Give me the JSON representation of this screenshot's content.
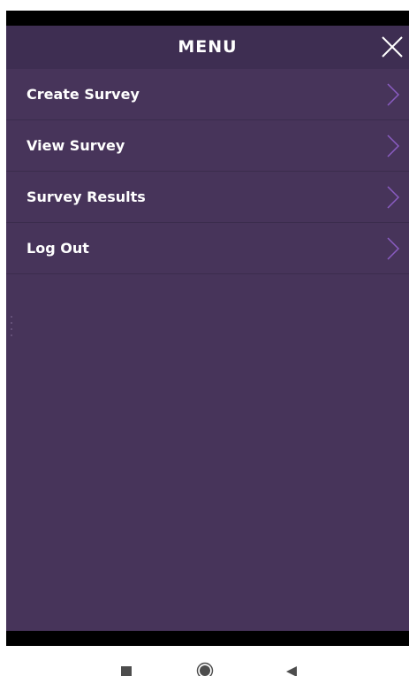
{
  "header": {
    "title": "MENU",
    "close_icon": "close-icon"
  },
  "menu": {
    "items": [
      {
        "label": "Create Survey",
        "icon": "chevron-right-icon"
      },
      {
        "label": "View Survey",
        "icon": "chevron-right-icon"
      },
      {
        "label": "Survey Results",
        "icon": "chevron-right-icon"
      },
      {
        "label": "Log Out",
        "icon": "chevron-right-icon"
      }
    ]
  },
  "navigation_bar": {
    "buttons": [
      "recents-icon",
      "home-icon",
      "back-icon"
    ]
  },
  "colors": {
    "panel_background": "#47345a",
    "header_background": "#3e2e52",
    "chevron": "#8a5cc2",
    "text": "#ffffff"
  }
}
